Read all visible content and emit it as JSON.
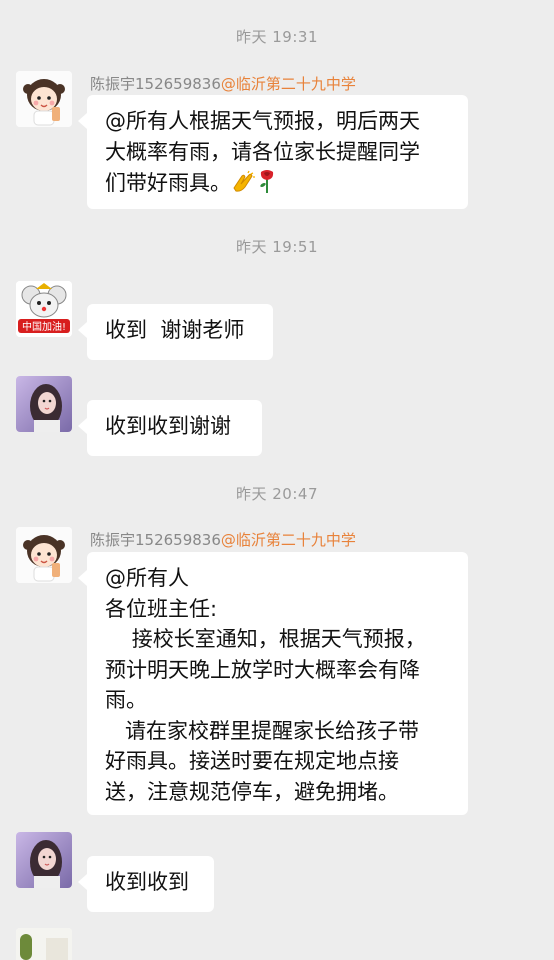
{
  "messages": [
    {
      "time": "昨天 19:31",
      "sender_name": "陈振宇152659836",
      "sender_org": "@临沂第二十九中学",
      "lines": [
        "@所有人根据天气预报，明后两天",
        "大概率有雨，请各位家长提醒同学",
        "们带好雨具。"
      ],
      "emojis": [
        "clapping-hands-emoji",
        "rose-emoji"
      ]
    },
    {
      "time": "昨天 19:51",
      "text": "收到  谢谢老师",
      "avatar": "mouse-cartoon-avatar",
      "avatar_badge": "中国加油!"
    },
    {
      "text": "收到收到谢谢",
      "avatar": "woman-photo-avatar"
    },
    {
      "time": "昨天 20:47",
      "sender_name": "陈振宇152659836",
      "sender_org": "@临沂第二十九中学",
      "lines": [
        "@所有人",
        "各位班主任:",
        "    接校长室通知，根据天气预报，",
        "预计明天晚上放学时大概率会有降",
        "雨。",
        "   请在家校群里提醒家长给孩子带",
        "好雨具。接送时要在规定地点接",
        "送，注意规范停车，避免拥堵。"
      ]
    },
    {
      "text": "收到收到",
      "avatar": "woman-photo-avatar"
    }
  ]
}
